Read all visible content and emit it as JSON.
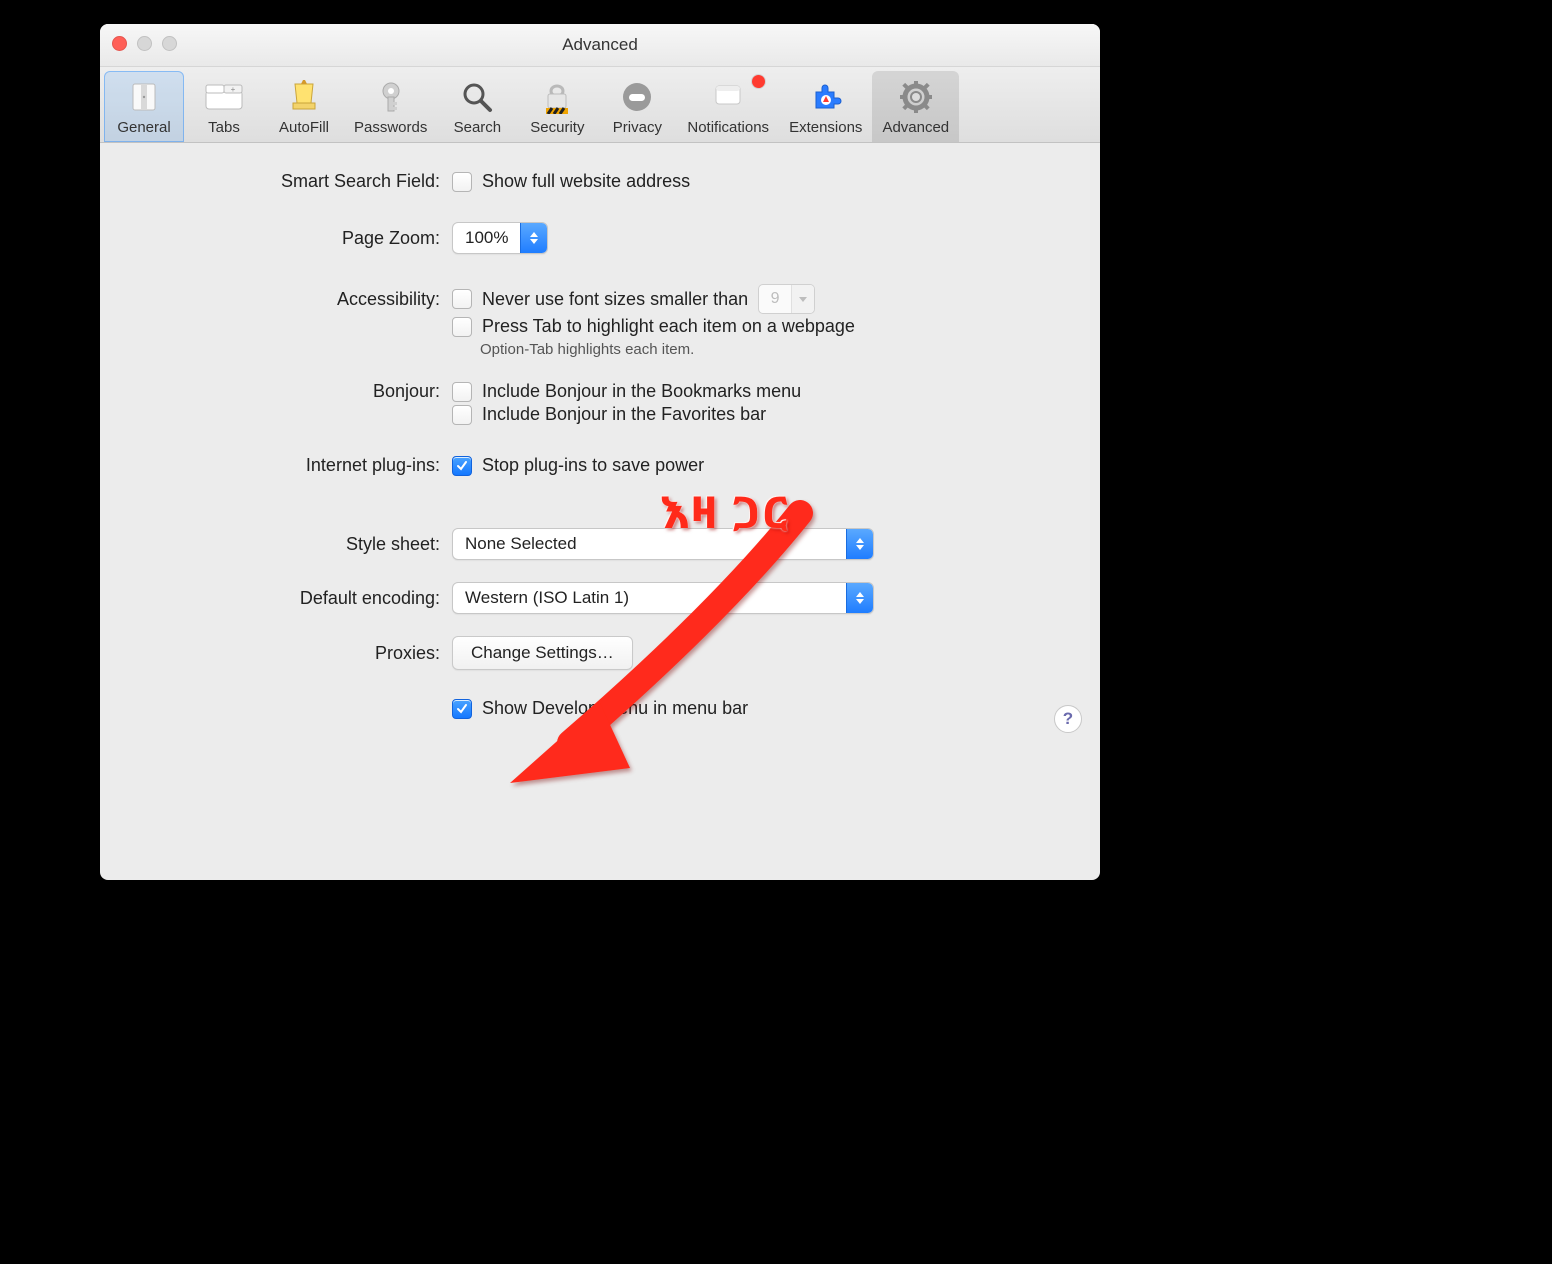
{
  "window": {
    "title": "Advanced"
  },
  "toolbar": {
    "items": [
      {
        "id": "general",
        "label": "General"
      },
      {
        "id": "tabs",
        "label": "Tabs"
      },
      {
        "id": "autofill",
        "label": "AutoFill"
      },
      {
        "id": "passwords",
        "label": "Passwords"
      },
      {
        "id": "search",
        "label": "Search"
      },
      {
        "id": "security",
        "label": "Security"
      },
      {
        "id": "privacy",
        "label": "Privacy"
      },
      {
        "id": "notifications",
        "label": "Notifications",
        "badge": true
      },
      {
        "id": "extensions",
        "label": "Extensions"
      },
      {
        "id": "advanced",
        "label": "Advanced",
        "selected": true
      }
    ]
  },
  "sections": {
    "smart_search": {
      "label": "Smart Search Field:",
      "show_full_url": {
        "checked": false,
        "label": "Show full website address"
      }
    },
    "page_zoom": {
      "label": "Page Zoom:",
      "value": "100%"
    },
    "accessibility": {
      "label": "Accessibility:",
      "min_font": {
        "checked": false,
        "label": "Never use font sizes smaller than",
        "value": "9"
      },
      "press_tab": {
        "checked": false,
        "label": "Press Tab to highlight each item on a webpage"
      },
      "hint": "Option-Tab highlights each item."
    },
    "bonjour": {
      "label": "Bonjour:",
      "bookmarks": {
        "checked": false,
        "label": "Include Bonjour in the Bookmarks menu"
      },
      "favorites": {
        "checked": false,
        "label": "Include Bonjour in the Favorites bar"
      }
    },
    "plugins": {
      "label": "Internet plug-ins:",
      "stop_power": {
        "checked": true,
        "label": "Stop plug-ins to save power"
      }
    },
    "style_sheet": {
      "label": "Style sheet:",
      "value": "None Selected"
    },
    "encoding": {
      "label": "Default encoding:",
      "value": "Western (ISO Latin 1)"
    },
    "proxies": {
      "label": "Proxies:",
      "button": "Change Settings…"
    },
    "develop": {
      "checked": true,
      "label": "Show Develop menu in menu bar"
    }
  },
  "help_tooltip": "?",
  "annotation": {
    "text": "እዛ  ጋር"
  }
}
